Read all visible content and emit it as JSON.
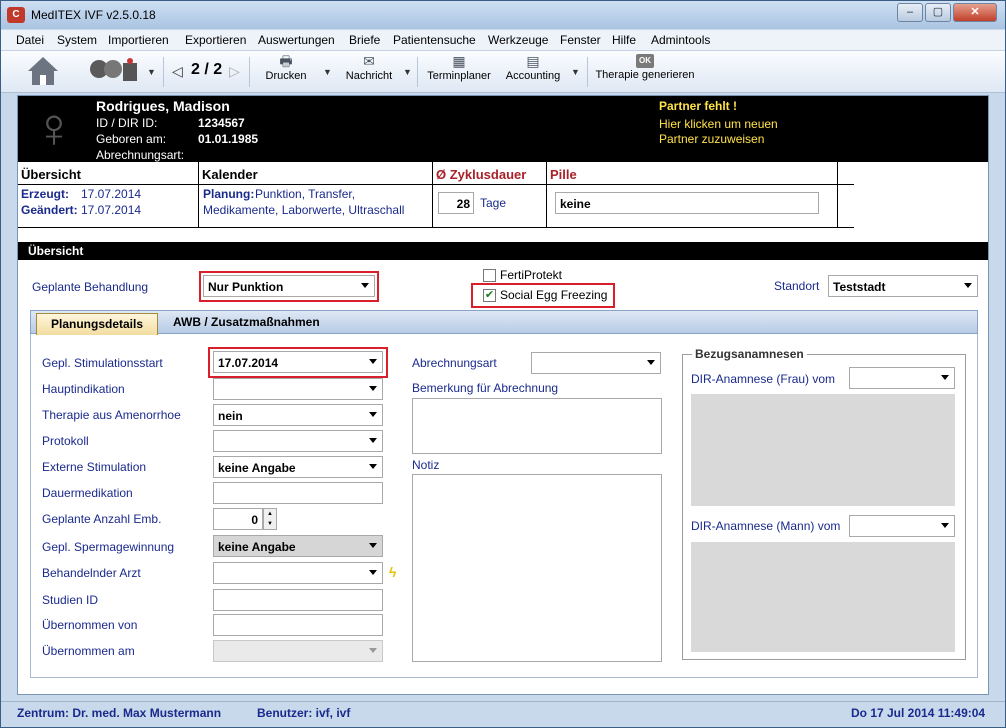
{
  "window": {
    "title": "MedITEX IVF v2.5.0.18",
    "minimize": "–",
    "maximize": "▢",
    "close": "✕"
  },
  "menu": [
    "Datei",
    "System",
    "Importieren",
    "Exportieren",
    "Auswertungen",
    "Briefe",
    "Patientensuche",
    "Werkzeuge",
    "Fenster",
    "Hilfe",
    "Admintools"
  ],
  "toolbar": {
    "pager": "2 / 2",
    "print": "Drucken",
    "message": "Nachricht",
    "scheduler": "Terminplaner",
    "accounting": "Accounting",
    "ok_badge": "OK",
    "therapy": "Therapie generieren"
  },
  "patient": {
    "name": "Rodrigues, Madison",
    "id_label": "ID / DIR ID:",
    "id_value": "1234567",
    "born_label": "Geboren am:",
    "born_value": "01.01.1985",
    "billing_label": "Abrechnungsart:",
    "partner_missing": "Partner fehlt !",
    "partner_hint1": "Hier klicken um neuen",
    "partner_hint2": "Partner zuzuweisen"
  },
  "summary": {
    "h_overview": "Übersicht",
    "created_label": "Erzeugt:",
    "created_value": "17.07.2014",
    "changed_label": "Geändert:",
    "changed_value": "17.07.2014",
    "h_calendar": "Kalender",
    "plan_label": "Planung:",
    "plan_text1": "Punktion, Transfer,",
    "plan_text2": "Medikamente, Laborwerte, Ultraschall",
    "h_cycle": "Ø Zyklusdauer",
    "cycle_value": "28",
    "cycle_unit": "Tage",
    "h_pill": "Pille",
    "pill_value": "keine"
  },
  "overview": {
    "section": "Übersicht",
    "planned_label": "Geplante Behandlung",
    "planned_value": "Nur Punktion",
    "ferti_label": "FertiProtekt",
    "ferti_checked": false,
    "social_label": "Social Egg Freezing",
    "social_checked": true,
    "location_label": "Standort",
    "location_value": "Teststadt"
  },
  "tabs": [
    "Planungsdetails",
    "AWB / Zusatzmaßnahmen"
  ],
  "details": {
    "fields": [
      {
        "label": "Gepl. Stimulationsstart",
        "value": "17.07.2014"
      },
      {
        "label": "Hauptindikation",
        "value": ""
      },
      {
        "label": "Therapie aus Amenorrhoe",
        "value": "nein"
      },
      {
        "label": "Protokoll",
        "value": ""
      },
      {
        "label": "Externe Stimulation",
        "value": "keine Angabe"
      },
      {
        "label": "Dauermedikation",
        "value": ""
      },
      {
        "label": "Geplante Anzahl Emb.",
        "value": "0"
      },
      {
        "label": "Gepl. Spermagewinnung",
        "value": "keine Angabe"
      },
      {
        "label": "Behandelnder Arzt",
        "value": ""
      },
      {
        "label": "Studien ID",
        "value": ""
      },
      {
        "label": "Übernommen von",
        "value": ""
      },
      {
        "label": "Übernommen am",
        "value": ""
      }
    ],
    "billing_type_label": "Abrechnungsart",
    "billing_note_label": "Bemerkung für Abrechnung",
    "note_label": "Notiz",
    "anamnesis_legend": "Bezugsanamnesen",
    "anamnesis_female": "DIR-Anamnese (Frau) vom",
    "anamnesis_male": "DIR-Anamnese (Mann) vom"
  },
  "status": {
    "center": "Zentrum: Dr. med. Max Mustermann",
    "user": "Benutzer: ivf, ivf",
    "datetime": "Do 17 Jul 2014 11:49:04"
  },
  "colors": {
    "highlight": "#d9202a",
    "label_blue": "#1a2a8c",
    "header_red": "#a8222a",
    "partner_yellow": "#ffe24a"
  }
}
